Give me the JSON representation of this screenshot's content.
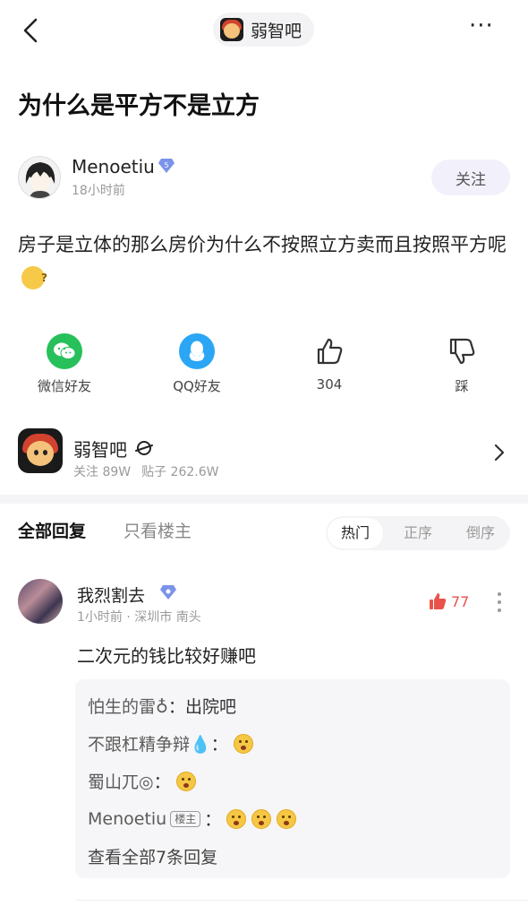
{
  "topbar": {
    "forum_title": "弱智吧",
    "more_label": "···"
  },
  "post": {
    "title": "为什么是平方不是立方",
    "author": {
      "name": "Menoetiu",
      "level": "5",
      "time": "18小时前"
    },
    "follow_label": "关注",
    "body": "房子是立体的那么房价为什么不按照立方卖而且按照平方呢"
  },
  "actions": {
    "wechat_label": "微信好友",
    "qq_label": "QQ好友",
    "like_count": "304",
    "dislike_label": "踩"
  },
  "forum": {
    "name": "弱智吧",
    "followers": "关注 89W",
    "posts": "贴子 262.6W"
  },
  "reply_tabs": {
    "all_label": "全部回复",
    "op_only_label": "只看楼主",
    "sort_options": [
      "热门",
      "正序",
      "倒序"
    ],
    "active_sort": "热门"
  },
  "comment": {
    "author": "我烈割去",
    "meta": "1小时前 · 深圳市 南头",
    "likes": "77",
    "text": "二次元的钱比较好赚吧",
    "sub_replies": [
      {
        "author": "怕生的雷♁",
        "text": "出院吧"
      },
      {
        "author": "不跟杠精争辩💧",
        "text": ""
      },
      {
        "author": "蜀山兀◎",
        "text": ""
      },
      {
        "author": "Menoetiu",
        "tag": "楼主",
        "text": ""
      }
    ],
    "view_all_label": "查看全部7条回复"
  },
  "colors": {
    "accent_red": "#e9524a",
    "wechat_green": "#27c05a",
    "qq_blue": "#2aa6f5",
    "follow_bg": "#f2f0fb"
  }
}
